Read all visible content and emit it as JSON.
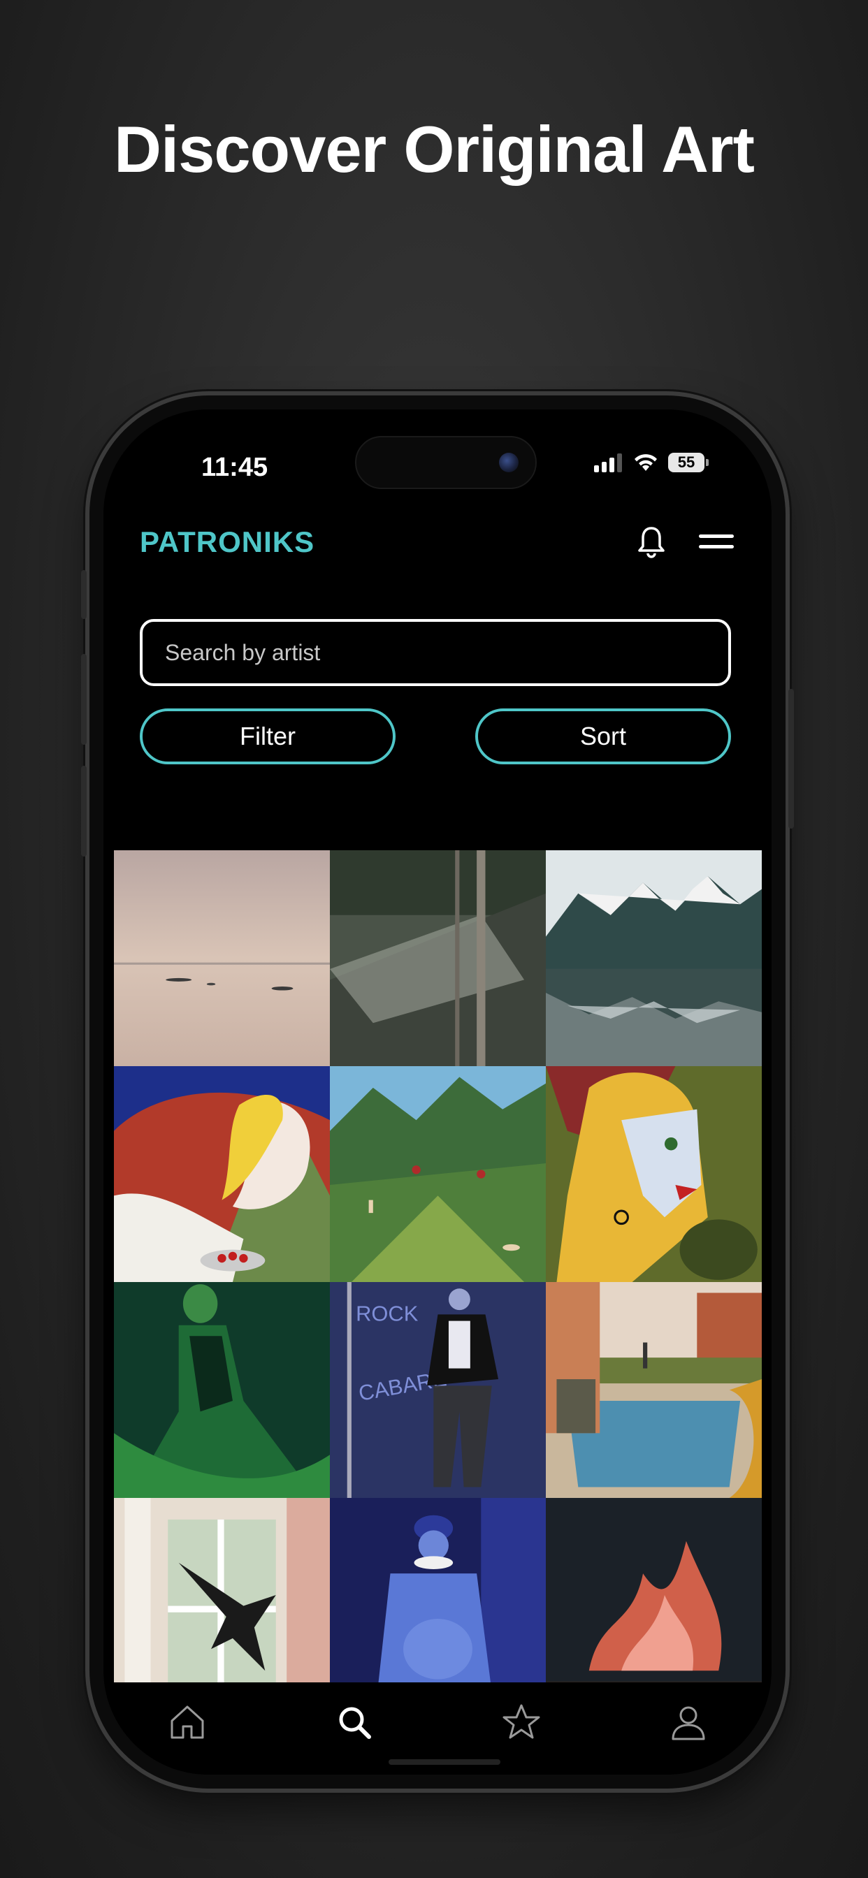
{
  "headline": "Discover Original Art",
  "status_bar": {
    "time": "11:45",
    "battery": "55"
  },
  "app": {
    "brand": "PATRONIKS",
    "search_placeholder": "Search by artist",
    "filter_label": "Filter",
    "sort_label": "Sort"
  },
  "gallery": {
    "items": [
      "artwork-misty-sea",
      "artwork-forest-net",
      "artwork-mountain-lake",
      "artwork-blonde-woman-cherries",
      "artwork-green-valley",
      "artwork-cubist-portrait",
      "artwork-woman-in-green",
      "artwork-cabaret-dancer",
      "artwork-swimming-pool",
      "artwork-crow-window",
      "artwork-blue-figure",
      "artwork-fire"
    ]
  },
  "tabbar": {
    "tabs": [
      "home-icon",
      "search-icon",
      "star-icon",
      "profile-icon"
    ],
    "active": "search-icon"
  },
  "colors": {
    "accent": "#4fc6c8",
    "background": "#000000",
    "text": "#ffffff"
  }
}
